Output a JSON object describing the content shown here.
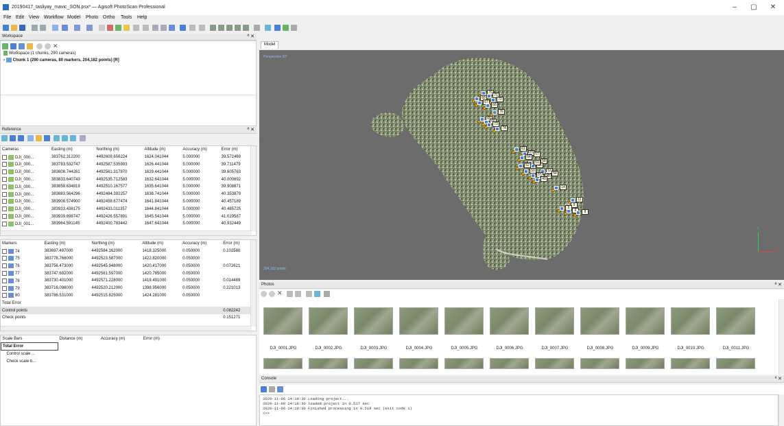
{
  "window": {
    "title": "20190417_tasliyay_mavic_SON.psx* — Agisoft PhotoScan Professional",
    "min": "–",
    "max": "▢",
    "close": "✕"
  },
  "menu": [
    "File",
    "Edit",
    "View",
    "Workflow",
    "Model",
    "Photo",
    "Ortho",
    "Tools",
    "Help"
  ],
  "workspace": {
    "header": "Workspace",
    "root": "Workspace (1 chunks, 290 cameras)",
    "chunk": "Chunk 1 (290 cameras, 80 markers, 204,182 points) [R]"
  },
  "reference": {
    "header": "Reference",
    "camera_cols": [
      "Cameras",
      "Easting (m)",
      "Northing (m)",
      "Altitude (m)",
      "Accuracy (m)",
      "Error (m)"
    ],
    "cameras": [
      [
        "DJI_000...",
        "383762.312200",
        "4492609.656224",
        "1624.041044",
        "5.000000",
        "39.572469"
      ],
      [
        "DJI_000...",
        "383783.532747",
        "4492587.535993",
        "1626.441044",
        "5.000000",
        "39.711479"
      ],
      [
        "DJI_000...",
        "383808.744261",
        "4492561.317870",
        "1629.441044",
        "5.000000",
        "39.605763"
      ],
      [
        "DJI_000...",
        "383833.640743",
        "4492535.712583",
        "1632.641044",
        "5.000000",
        "40.000692"
      ],
      [
        "DJI_000...",
        "383858.634819",
        "4492510.167577",
        "1635.641044",
        "5.000000",
        "39.908871"
      ],
      [
        "DJI_000...",
        "383883.564296",
        "4492484.392257",
        "1638.741044",
        "5.000000",
        "40.353879"
      ],
      [
        "DJI_000...",
        "383908.574900",
        "4492458.677474",
        "1641.841044",
        "5.000000",
        "40.457189"
      ],
      [
        "DJI_000...",
        "383933.438175",
        "4492433.011357",
        "1644.841044",
        "5.000000",
        "40.485725"
      ],
      [
        "DJI_000...",
        "383939.698747",
        "4492426.557891",
        "1645.541044",
        "5.000000",
        "41.019587"
      ],
      [
        "DJI_001...",
        "383964.591145",
        "4492400.783442",
        "1647.641044",
        "5.000000",
        "40.932449"
      ]
    ],
    "marker_cols": [
      "Markers",
      "Easting (m)",
      "Northing (m)",
      "Altitude (m)",
      "Accuracy (m)",
      "Error (m)"
    ],
    "markers": [
      [
        "74",
        "383697.497000",
        "4492584.162000",
        "1418.325000",
        "0.050000",
        "0.102580"
      ],
      [
        "75",
        "383778.766000",
        "4492523.587000",
        "1422.820000",
        "0.050000",
        ""
      ],
      [
        "76",
        "383756.473000",
        "4492545.948000",
        "1420.417000",
        "0.050000",
        "0.072621"
      ],
      [
        "77",
        "383747.692000",
        "4492561.597000",
        "1420.785000",
        "0.050000",
        ""
      ],
      [
        "78",
        "383730.401000",
        "4492571.228000",
        "1419.491000",
        "0.050000",
        "0.014489"
      ],
      [
        "79",
        "383716.096000",
        "4492520.212000",
        "1398.956000",
        "0.050000",
        "0.221013"
      ],
      [
        "80",
        "383786.531000",
        "4492515.825000",
        "1424.281000",
        "0.050000",
        ""
      ]
    ],
    "total_error": "Total Error",
    "control_points": "Control points",
    "control_val": "0.082242",
    "check_points": "Check points",
    "check_val": "0.151271",
    "scale_cols": [
      "Scale Bars",
      "Distance (m)",
      "Accuracy (m)",
      "Error (m)"
    ],
    "scale_total": "Total Error",
    "scale_control": "Control scale ...",
    "scale_check": "Check scale b..."
  },
  "model": {
    "tab": "Model",
    "view_label": "Perspective 30°",
    "points": "204,182 points",
    "markers": [
      "70",
      "71",
      "69",
      "72",
      "76",
      "67",
      "68",
      "65",
      "66",
      "73",
      "74",
      "61",
      "62",
      "57",
      "58",
      "63",
      "64",
      "53",
      "54",
      "55",
      "48",
      "49",
      "50",
      "51",
      "52",
      "14",
      "11",
      "9",
      "5",
      "6",
      "8"
    ]
  },
  "photos": {
    "header": "Photos",
    "files": [
      "DJI_0001.JPG",
      "DJI_0002.JPG",
      "DJI_0003.JPG",
      "DJI_0004.JPG",
      "DJI_0005.JPG",
      "DJI_0006.JPG",
      "DJI_0007.JPG",
      "DJI_0008.JPG",
      "DJI_0009.JPG",
      "DJI_0010.JPG",
      "DJI_0011.JPG"
    ]
  },
  "console": {
    "header": "Console",
    "lines": [
      "2020-11-06 14:19:30 Loading project...",
      "2020-11-06 14:19:30 loaded project in 0.517 sec",
      "2020-11-06 14:19:30 Finished processing in 0.519 sec (exit code 1)",
      ">>>"
    ]
  },
  "axes": {
    "y": "Y",
    "x": "X"
  }
}
